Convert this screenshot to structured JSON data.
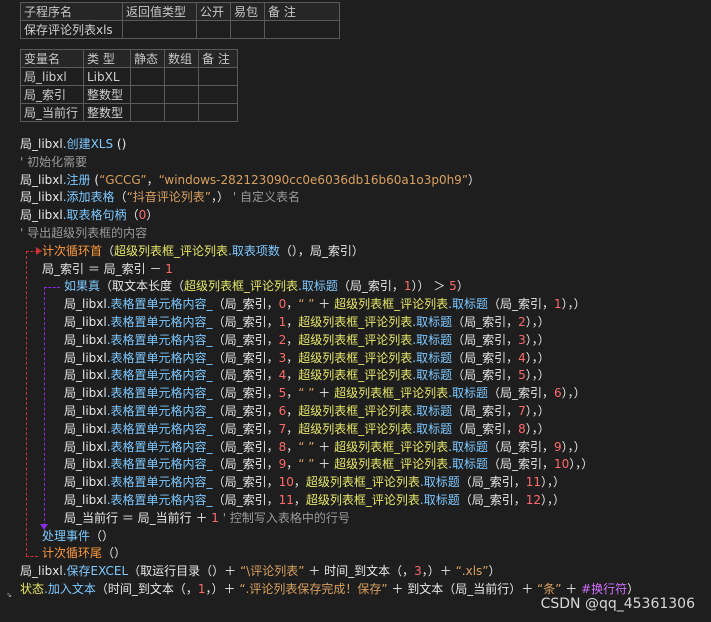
{
  "sub_table": {
    "headers": [
      "子程序名",
      "返回值类型",
      "公开",
      "易包",
      "备 注"
    ],
    "row": [
      "保存评论列表xls",
      "",
      "",
      "",
      ""
    ]
  },
  "var_table": {
    "headers": [
      "变量名",
      "类 型",
      "静态",
      "数组",
      "备 注"
    ],
    "rows": [
      [
        "局_libxl",
        "LibXL",
        "",
        "",
        ""
      ],
      [
        "局_索引",
        "整数型",
        "",
        "",
        ""
      ],
      [
        "局_当前行",
        "整数型",
        "",
        "",
        ""
      ]
    ]
  },
  "code": [
    {
      "indent": 0,
      "parts": [
        [
          "w",
          "局_libxl"
        ],
        [
          "c",
          "."
        ],
        [
          "c",
          "创建XLS"
        ],
        [
          "w",
          " ()"
        ]
      ]
    },
    {
      "indent": 0,
      "parts": [
        [
          "g",
          "' 初始化需要"
        ]
      ]
    },
    {
      "indent": 0,
      "parts": [
        [
          "w",
          "局_libxl"
        ],
        [
          "c",
          ".注册"
        ],
        [
          "w",
          " ("
        ],
        [
          "s",
          "“GCCG”"
        ],
        [
          "w",
          "，"
        ],
        [
          "s",
          "“windows-282123090cc0e6036db16b60a1o3p0h9”"
        ],
        [
          "w",
          "）"
        ]
      ]
    },
    {
      "indent": 0,
      "parts": [
        [
          "w",
          "局_libxl"
        ],
        [
          "c",
          ".添加表格"
        ],
        [
          "w",
          "（"
        ],
        [
          "s",
          "“抖音评论列表”"
        ],
        [
          "w",
          "，）"
        ],
        [
          "g",
          " ' 自定义表名"
        ]
      ]
    },
    {
      "indent": 0,
      "parts": [
        [
          "w",
          "局_libxl"
        ],
        [
          "c",
          ".取表格句柄"
        ],
        [
          "w",
          "（"
        ],
        [
          "n",
          "0"
        ],
        [
          "w",
          "）"
        ]
      ]
    },
    {
      "indent": 0,
      "parts": [
        [
          "g",
          "' 导出超级列表框的内容"
        ]
      ]
    },
    {
      "indent": 1,
      "parts": [
        [
          "o",
          "计次循环首"
        ],
        [
          "w",
          "（"
        ],
        [
          "yl",
          "超级列表框_评论列表"
        ],
        [
          "c",
          ".取表项数"
        ],
        [
          "w",
          "（），局_索引）"
        ]
      ]
    },
    {
      "indent": 2,
      "parts": [
        [
          "w",
          "局_索引 ＝ 局_索引 － "
        ],
        [
          "n",
          "1"
        ]
      ]
    },
    {
      "indent": 3,
      "parts": [
        [
          "c",
          "如果真"
        ],
        [
          "w",
          "（取文本长度（"
        ],
        [
          "yl",
          "超级列表框_评论列表"
        ],
        [
          "c",
          ".取标题"
        ],
        [
          "w",
          "（局_索引，"
        ],
        [
          "n",
          "1"
        ],
        [
          "w",
          "）） ＞ "
        ],
        [
          "n",
          "5"
        ],
        [
          "w",
          "）"
        ]
      ]
    },
    {
      "indent": 4,
      "parts": [
        [
          "w",
          "局_libxl"
        ],
        [
          "c",
          ".表格置单元格内容_"
        ],
        [
          "w",
          "（局_索引，"
        ],
        [
          "n",
          "0"
        ],
        [
          "w",
          "，"
        ],
        [
          "s",
          "“ ”"
        ],
        [
          "w",
          " ＋ "
        ],
        [
          "yl",
          "超级列表框_评论列表"
        ],
        [
          "c",
          ".取标题"
        ],
        [
          "w",
          "（局_索引，"
        ],
        [
          "n",
          "1"
        ],
        [
          "w",
          "），）"
        ]
      ]
    },
    {
      "indent": 4,
      "parts": [
        [
          "w",
          "局_libxl"
        ],
        [
          "c",
          ".表格置单元格内容_"
        ],
        [
          "w",
          "（局_索引，"
        ],
        [
          "n",
          "1"
        ],
        [
          "w",
          "，"
        ],
        [
          "yl",
          "超级列表框_评论列表"
        ],
        [
          "c",
          ".取标题"
        ],
        [
          "w",
          "（局_索引，"
        ],
        [
          "n",
          "2"
        ],
        [
          "w",
          "），）"
        ]
      ]
    },
    {
      "indent": 4,
      "parts": [
        [
          "w",
          "局_libxl"
        ],
        [
          "c",
          ".表格置单元格内容_"
        ],
        [
          "w",
          "（局_索引，"
        ],
        [
          "n",
          "2"
        ],
        [
          "w",
          "，"
        ],
        [
          "yl",
          "超级列表框_评论列表"
        ],
        [
          "c",
          ".取标题"
        ],
        [
          "w",
          "（局_索引，"
        ],
        [
          "n",
          "3"
        ],
        [
          "w",
          "），）"
        ]
      ]
    },
    {
      "indent": 4,
      "parts": [
        [
          "w",
          "局_libxl"
        ],
        [
          "c",
          ".表格置单元格内容_"
        ],
        [
          "w",
          "（局_索引，"
        ],
        [
          "n",
          "3"
        ],
        [
          "w",
          "，"
        ],
        [
          "yl",
          "超级列表框_评论列表"
        ],
        [
          "c",
          ".取标题"
        ],
        [
          "w",
          "（局_索引，"
        ],
        [
          "n",
          "4"
        ],
        [
          "w",
          "），）"
        ]
      ]
    },
    {
      "indent": 4,
      "parts": [
        [
          "w",
          "局_libxl"
        ],
        [
          "c",
          ".表格置单元格内容_"
        ],
        [
          "w",
          "（局_索引，"
        ],
        [
          "n",
          "4"
        ],
        [
          "w",
          "，"
        ],
        [
          "yl",
          "超级列表框_评论列表"
        ],
        [
          "c",
          ".取标题"
        ],
        [
          "w",
          "（局_索引，"
        ],
        [
          "n",
          "5"
        ],
        [
          "w",
          "），）"
        ]
      ]
    },
    {
      "indent": 4,
      "parts": [
        [
          "w",
          "局_libxl"
        ],
        [
          "c",
          ".表格置单元格内容_"
        ],
        [
          "w",
          "（局_索引，"
        ],
        [
          "n",
          "5"
        ],
        [
          "w",
          "，"
        ],
        [
          "s",
          "“ ”"
        ],
        [
          "w",
          " ＋ "
        ],
        [
          "yl",
          "超级列表框_评论列表"
        ],
        [
          "c",
          ".取标题"
        ],
        [
          "w",
          "（局_索引，"
        ],
        [
          "n",
          "6"
        ],
        [
          "w",
          "），）"
        ]
      ]
    },
    {
      "indent": 4,
      "parts": [
        [
          "w",
          "局_libxl"
        ],
        [
          "c",
          ".表格置单元格内容_"
        ],
        [
          "w",
          "（局_索引，"
        ],
        [
          "n",
          "6"
        ],
        [
          "w",
          "，"
        ],
        [
          "yl",
          "超级列表框_评论列表"
        ],
        [
          "c",
          ".取标题"
        ],
        [
          "w",
          "（局_索引，"
        ],
        [
          "n",
          "7"
        ],
        [
          "w",
          "），）"
        ]
      ]
    },
    {
      "indent": 4,
      "parts": [
        [
          "w",
          "局_libxl"
        ],
        [
          "c",
          ".表格置单元格内容_"
        ],
        [
          "w",
          "（局_索引，"
        ],
        [
          "n",
          "7"
        ],
        [
          "w",
          "，"
        ],
        [
          "yl",
          "超级列表框_评论列表"
        ],
        [
          "c",
          ".取标题"
        ],
        [
          "w",
          "（局_索引，"
        ],
        [
          "n",
          "8"
        ],
        [
          "w",
          "），）"
        ]
      ]
    },
    {
      "indent": 4,
      "parts": [
        [
          "w",
          "局_libxl"
        ],
        [
          "c",
          ".表格置单元格内容_"
        ],
        [
          "w",
          "（局_索引，"
        ],
        [
          "n",
          "8"
        ],
        [
          "w",
          "，"
        ],
        [
          "s",
          "“ ”"
        ],
        [
          "w",
          " ＋ "
        ],
        [
          "yl",
          "超级列表框_评论列表"
        ],
        [
          "c",
          ".取标题"
        ],
        [
          "w",
          "（局_索引，"
        ],
        [
          "n",
          "9"
        ],
        [
          "w",
          "），）"
        ]
      ]
    },
    {
      "indent": 4,
      "parts": [
        [
          "w",
          "局_libxl"
        ],
        [
          "c",
          ".表格置单元格内容_"
        ],
        [
          "w",
          "（局_索引，"
        ],
        [
          "n",
          "9"
        ],
        [
          "w",
          "，"
        ],
        [
          "s",
          "“ ”"
        ],
        [
          "w",
          " ＋ "
        ],
        [
          "yl",
          "超级列表框_评论列表"
        ],
        [
          "c",
          ".取标题"
        ],
        [
          "w",
          "（局_索引，"
        ],
        [
          "n",
          "10"
        ],
        [
          "w",
          "），）"
        ]
      ]
    },
    {
      "indent": 4,
      "parts": [
        [
          "w",
          "局_libxl"
        ],
        [
          "c",
          ".表格置单元格内容_"
        ],
        [
          "w",
          "（局_索引，"
        ],
        [
          "n",
          "10"
        ],
        [
          "w",
          "，"
        ],
        [
          "yl",
          "超级列表框_评论列表"
        ],
        [
          "c",
          ".取标题"
        ],
        [
          "w",
          "（局_索引，"
        ],
        [
          "n",
          "11"
        ],
        [
          "w",
          "），）"
        ]
      ]
    },
    {
      "indent": 4,
      "parts": [
        [
          "w",
          "局_libxl"
        ],
        [
          "c",
          ".表格置单元格内容_"
        ],
        [
          "w",
          "（局_索引，"
        ],
        [
          "n",
          "11"
        ],
        [
          "w",
          "，"
        ],
        [
          "yl",
          "超级列表框_评论列表"
        ],
        [
          "c",
          ".取标题"
        ],
        [
          "w",
          "（局_索引，"
        ],
        [
          "n",
          "12"
        ],
        [
          "w",
          "），）"
        ]
      ]
    },
    {
      "indent": 4,
      "parts": [
        [
          "w",
          "局_当前行 ＝ 局_当前行 ＋ "
        ],
        [
          "n",
          "1"
        ],
        [
          "g",
          "  ' 控制写入表格中的行号"
        ]
      ]
    },
    {
      "indent": 2,
      "parts": [
        [
          "c",
          "处理事件"
        ],
        [
          "w",
          "（）"
        ]
      ]
    },
    {
      "indent": 1,
      "parts": [
        [
          "o",
          "计次循环尾"
        ],
        [
          "w",
          "（）"
        ]
      ]
    },
    {
      "indent": 0,
      "parts": [
        [
          "w",
          "局_libxl"
        ],
        [
          "c",
          ".保存EXCEL"
        ],
        [
          "w",
          "（取运行目录（）＋ "
        ],
        [
          "s",
          "“\\评论列表”"
        ],
        [
          "w",
          " ＋ 时间_到文本（，"
        ],
        [
          "n",
          "3"
        ],
        [
          "w",
          "，）＋ "
        ],
        [
          "s",
          "“.xls”"
        ],
        [
          "w",
          "）"
        ]
      ]
    },
    {
      "indent": 0,
      "parts": [
        [
          "yl",
          "状态"
        ],
        [
          "c",
          ".加入文本"
        ],
        [
          "w",
          "（时间_到文本（，"
        ],
        [
          "n",
          "1"
        ],
        [
          "w",
          "，）＋ "
        ],
        [
          "s",
          "“.评论列表保存完成！保存”"
        ],
        [
          "w",
          " ＋ 到文本（局_当前行）＋ "
        ],
        [
          "s",
          "“条”"
        ],
        [
          "w",
          " ＋ "
        ],
        [
          "p",
          "#换行符"
        ],
        [
          "w",
          "）"
        ]
      ]
    }
  ],
  "watermark": "CSDN @qq_45361306",
  "colors": {
    "background": "#1e1e1e",
    "method": "#7ec8ff",
    "string": "#d8a060",
    "number": "#ff6a6a",
    "comment": "#9a9a9a",
    "control_loop": "#ff9a40",
    "control_if": "#7ec8ff",
    "guide_loop": "#c83232",
    "guide_if": "#8a2be2"
  }
}
